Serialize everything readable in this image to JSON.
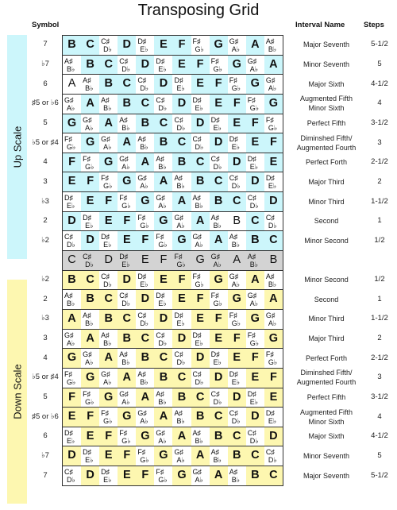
{
  "title": "Transposing Grid",
  "headers": {
    "symbol": "Symbol",
    "interval": "Interval Name",
    "steps": "Steps"
  },
  "sections": {
    "up": "Up Scale",
    "down": "Down Scale"
  },
  "colors": {
    "up": "#ccf6fb",
    "down": "#fdf7b0",
    "reference": "#d3d3d3"
  },
  "rows": [
    {
      "section": "up",
      "symbol": "7",
      "interval": [
        "Major Seventh"
      ],
      "steps": "5-1/2",
      "cells": [
        "B",
        "C",
        "C#|Db",
        "D",
        "D#|Eb",
        "E",
        "F",
        "F#|Gb",
        "G",
        "G#|Ab",
        "A",
        "A#|Bb"
      ]
    },
    {
      "section": "up",
      "symbol": "♭7",
      "interval": [
        "Minor Seventh"
      ],
      "steps": "5",
      "cells": [
        "A#|Bb",
        "B",
        "C",
        "C#|Db",
        "D",
        "D#|Eb",
        "E",
        "F",
        "F#|Gb",
        "G",
        "G#|Ab",
        "A"
      ]
    },
    {
      "section": "up",
      "symbol": "6",
      "interval": [
        "Major Sixth"
      ],
      "steps": "4-1/2",
      "cells": [
        "A*",
        "A#|Bb",
        "B",
        "C",
        "C#|Db",
        "D",
        "D#|Eb",
        "E",
        "F",
        "F#|Gb",
        "G",
        "G#|Ab"
      ]
    },
    {
      "section": "up",
      "symbol": "♯5 or ♭6",
      "interval": [
        "Augmented Fifth",
        "Minor Sixth"
      ],
      "steps": "4",
      "cells": [
        "G#|Ab",
        "A",
        "A#|Bb",
        "B",
        "C",
        "C#|Db",
        "D",
        "D#|Eb",
        "E",
        "F",
        "F#|Gb",
        "G"
      ]
    },
    {
      "section": "up",
      "symbol": "5",
      "interval": [
        "Perfect Fifth"
      ],
      "steps": "3-1/2",
      "cells": [
        "G",
        "G#|Ab",
        "A",
        "A#|Bb",
        "B",
        "C",
        "C#|Db",
        "D",
        "D#|Eb",
        "E",
        "F",
        "F#|Gb"
      ]
    },
    {
      "section": "up",
      "symbol": "♭5 or ♯4",
      "interval": [
        "Diminshed Fifth/",
        "Augmented Fourth"
      ],
      "steps": "3",
      "cells": [
        "F#|Gb",
        "G",
        "G#|Ab",
        "A",
        "A#|Bb",
        "B",
        "C",
        "C#|Db",
        "D",
        "D#|Eb",
        "E",
        "F"
      ]
    },
    {
      "section": "up",
      "symbol": "4",
      "interval": [
        "Perfect Forth"
      ],
      "steps": "2-1/2",
      "cells": [
        "F",
        "F#|Gb",
        "G",
        "G#|Ab",
        "A",
        "A#|Bb",
        "B",
        "C",
        "C#|Db",
        "D",
        "D#|Eb",
        "E"
      ]
    },
    {
      "section": "up",
      "symbol": "3",
      "interval": [
        "Major Third"
      ],
      "steps": "2",
      "cells": [
        "E",
        "F",
        "F#|Gb",
        "G",
        "G#|Ab",
        "A",
        "A#|Bb",
        "B",
        "C",
        "C#|Db",
        "D",
        "D#|Eb"
      ]
    },
    {
      "section": "up",
      "symbol": "♭3",
      "interval": [
        "Minor Third"
      ],
      "steps": "1-1/2",
      "cells": [
        "D#|Eb",
        "E",
        "F",
        "F#|Gb",
        "G",
        "G#|Ab",
        "A",
        "A#|Bb",
        "B",
        "C",
        "C#|Db",
        "D"
      ]
    },
    {
      "section": "up",
      "symbol": "2",
      "interval": [
        "Second"
      ],
      "steps": "1",
      "cells": [
        "D",
        "D#|Eb",
        "E",
        "F",
        "F#|Gb",
        "G",
        "G#|Ab",
        "A",
        "A#|Bb",
        "B*",
        "C",
        "C#|Db"
      ]
    },
    {
      "section": "up",
      "symbol": "♭2",
      "interval": [
        "Minor Second"
      ],
      "steps": "1/2",
      "cells": [
        "C#|Db",
        "D",
        "D#|Eb",
        "E",
        "F",
        "F#|Gb",
        "G",
        "G#|Ab",
        "A",
        "A#|Bb",
        "B",
        "C"
      ]
    },
    {
      "section": "ref",
      "symbol": "",
      "interval": [],
      "steps": "",
      "cells": [
        "C",
        "C#|Db",
        "D",
        "D#|Eb",
        "E",
        "F",
        "F#|Gb",
        "G",
        "G#|Ab",
        "A",
        "A#|Bb",
        "B"
      ]
    },
    {
      "section": "down",
      "symbol": "♭2",
      "interval": [
        "Minor Second"
      ],
      "steps": "1/2",
      "cells": [
        "B",
        "C",
        "C#|Db",
        "D",
        "D#|Eb",
        "E",
        "F",
        "F#|Gb",
        "G",
        "G#|Ab",
        "A",
        "A#|Bb"
      ]
    },
    {
      "section": "down",
      "symbol": "2",
      "interval": [
        "Second"
      ],
      "steps": "1",
      "cells": [
        "A#|Bb",
        "B",
        "C",
        "C#|Db",
        "D",
        "D#|Eb",
        "E",
        "F",
        "F#|Gb",
        "G",
        "G#|Ab",
        "A"
      ]
    },
    {
      "section": "down",
      "symbol": "♭3",
      "interval": [
        "Minor Third"
      ],
      "steps": "1-1/2",
      "cells": [
        "A",
        "A#|Bb",
        "B",
        "C",
        "C#|Db",
        "D",
        "D#|Eb",
        "E",
        "F",
        "F#|Gb",
        "G",
        "G#|Ab"
      ]
    },
    {
      "section": "down",
      "symbol": "3",
      "interval": [
        "Major Third"
      ],
      "steps": "2",
      "cells": [
        "G#|Ab",
        "A",
        "A#|Bb",
        "B",
        "C",
        "C#|Db",
        "D",
        "D#|Eb",
        "E",
        "F",
        "F#|Gb",
        "G"
      ]
    },
    {
      "section": "down",
      "symbol": "4",
      "interval": [
        "Perfect Forth"
      ],
      "steps": "2-1/2",
      "cells": [
        "G",
        "G#|Ab",
        "A",
        "A#|Bb",
        "B",
        "C",
        "C#|Db",
        "D",
        "D#|Eb",
        "E",
        "F",
        "F#|Gb"
      ]
    },
    {
      "section": "down",
      "symbol": "♭5 or ♯4",
      "interval": [
        "Diminshed Fifth/",
        "Augmented Fourth"
      ],
      "steps": "3",
      "cells": [
        "F#|Gb",
        "G",
        "G#|Ab",
        "A",
        "A#|Bb",
        "B",
        "C",
        "C#|Db",
        "D",
        "D#|Eb",
        "E",
        "F"
      ]
    },
    {
      "section": "down",
      "symbol": "5",
      "interval": [
        "Perfect Fifth"
      ],
      "steps": "3-1/2",
      "cells": [
        "F",
        "F#|Gb",
        "G",
        "G#|Ab",
        "A",
        "A#|Bb",
        "B",
        "C",
        "C#|Db",
        "D",
        "D#|Eb",
        "E"
      ]
    },
    {
      "section": "down",
      "symbol": "♯5 or ♭6",
      "interval": [
        "Augmented Fifth",
        "Minor Sixth"
      ],
      "steps": "4",
      "cells": [
        "E",
        "F",
        "F#|Gb",
        "G",
        "G#|Ab",
        "A",
        "A#|Bb",
        "B",
        "C",
        "C#|Db",
        "D",
        "D#|Eb"
      ]
    },
    {
      "section": "down",
      "symbol": "6",
      "interval": [
        "Major Sixth"
      ],
      "steps": "4-1/2",
      "cells": [
        "D#|Eb",
        "E",
        "F",
        "F#|Gb",
        "G",
        "G#|Ab",
        "A",
        "A#|Bb",
        "B",
        "C",
        "C#|Db",
        "D"
      ]
    },
    {
      "section": "down",
      "symbol": "♭7",
      "interval": [
        "Minor Seventh"
      ],
      "steps": "5",
      "cells": [
        "D",
        "D#|Eb",
        "E",
        "F",
        "F#|Gb",
        "G",
        "G#|Ab",
        "A",
        "A#|Bb",
        "B",
        "C",
        "C#|Db"
      ]
    },
    {
      "section": "down",
      "symbol": "7",
      "interval": [
        "Major Seventh"
      ],
      "steps": "5-1/2",
      "cells": [
        "C#|Db",
        "D",
        "D#|Eb",
        "E",
        "F",
        "F#|Gb",
        "G",
        "G#|Ab",
        "A",
        "A#|Bb",
        "B",
        "C"
      ]
    }
  ]
}
